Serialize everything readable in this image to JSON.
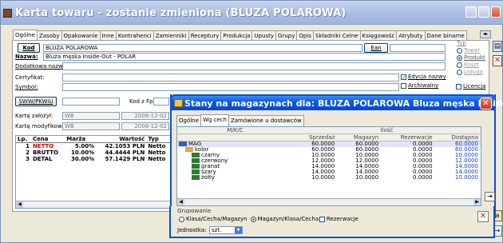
{
  "window": {
    "title": "Karta towaru - zostanie zmieniona (BLUZA POLAROWA)"
  },
  "tabs": [
    "Ogólne",
    "Zasoby",
    "Opakowanie",
    "Inne",
    "Kontrahenci",
    "Zamienniki",
    "Receptury",
    "Produkcja",
    "Upusty",
    "Grupy",
    "Opis",
    "Składniki Celne",
    "Księgowość",
    "Atrybuty",
    "Dane binarne"
  ],
  "form": {
    "kod_button": "Kod",
    "kod_value": "BLUZA POLAROWA",
    "nazwa_label": "Nazwa:",
    "nazwa_value": "Bluza męska Inside-Out - POLAR",
    "dodatkowa_label": "Dodatkowa nazwa:",
    "certyfikat_label": "Certyfikat:",
    "symbol_label": "Symbol:",
    "ean_button": "Ean",
    "swkw_button": "SWW/PKWiU",
    "kod_z_fpp_label": "Kod z Fpp:",
    "karte_zalozyl_label": "Kartę założył:",
    "karte_zalozyl_value": "WB",
    "karte_zalozyl_date": "2008-12-02",
    "karte_mod_label": "Kartę modyfikował:",
    "karte_mod_value": "WB",
    "karte_mod_date": "2008-12-02"
  },
  "typ": {
    "label": "Typ",
    "options": [
      "Towar",
      "Produkt",
      "Koszt",
      "Usługa"
    ],
    "selected": "Produkt"
  },
  "checks": {
    "edycja_nazwy": "Edycja nazwy",
    "archiwalny": "Archiwalny",
    "licencja": "Licencja"
  },
  "prices": {
    "headers": [
      "Lp.",
      "Cena",
      "Marża",
      "Wartość",
      "Typ"
    ],
    "rows": [
      {
        "lp": "1",
        "cena": "NETTO",
        "marza": "5.00%",
        "wartosc": "42.1053 PLN",
        "typ": "Netto"
      },
      {
        "lp": "2",
        "cena": "BRUTTO",
        "marza": "10.00%",
        "wartosc": "44.4444 PLN",
        "typ": "Netto"
      },
      {
        "lp": "3",
        "cena": "DETAL",
        "marza": "30.00%",
        "wartosc": "57.1429 PLN",
        "typ": "Netto"
      }
    ]
  },
  "dialog": {
    "title": "Stany na magazynach dla: BLUZA POLAROWA Bluza męska Inside-...",
    "tabs": [
      "Ogólne",
      "Wg cech",
      "Zamówione u dostawców"
    ],
    "active_tab": "Wg cech",
    "col_group": "Ilość",
    "headers": [
      "M/K/C",
      "Sprzedaż",
      "Magazyn",
      "Rezerwacje",
      "Dostępna"
    ],
    "rows": [
      {
        "name": "MAG",
        "sprzedaz": "60.0000",
        "magazyn": "60.0000",
        "rezerwacje": "0.0000",
        "dostepna": "60.0000",
        "level": 0
      },
      {
        "name": "kolor",
        "sprzedaz": "60.0000",
        "magazyn": "60.0000",
        "rezerwacje": "0.0000",
        "dostepna": "60.0000",
        "level": 1
      },
      {
        "name": "czarny",
        "sprzedaz": "10.0000",
        "magazyn": "10.0000",
        "rezerwacje": "0.0000",
        "dostepna": "10.0000",
        "level": 2
      },
      {
        "name": "czerwony",
        "sprzedaz": "12.0000",
        "magazyn": "12.0000",
        "rezerwacje": "0.0000",
        "dostepna": "12.0000",
        "level": 2
      },
      {
        "name": "granat",
        "sprzedaz": "14.0000",
        "magazyn": "14.0000",
        "rezerwacje": "0.0000",
        "dostepna": "14.0000",
        "level": 2
      },
      {
        "name": "szary",
        "sprzedaz": "14.0000",
        "magazyn": "14.0000",
        "rezerwacje": "0.0000",
        "dostepna": "14.0000",
        "level": 2
      },
      {
        "name": "żółty",
        "sprzedaz": "10.0000",
        "magazyn": "10.0000",
        "rezerwacje": "0.0000",
        "dostepna": "10.0000",
        "level": 2
      }
    ],
    "grupowanie_label": "Grupowanie",
    "grupowanie_options": [
      "Klasa/Cecha/Magazyn",
      "Magazyn/Klasa/Cecha"
    ],
    "grupowanie_selected": "Magazyn/Klasa/Cecha",
    "rezerwacje_check": "Rezerwacje",
    "jednostka_label": "Jednostka:",
    "jednostka_value": "szt."
  },
  "colors": {
    "title_blue": "#0c5be3",
    "netto_red": "#e00000",
    "dostepna_blue": "#1a3bd6"
  }
}
